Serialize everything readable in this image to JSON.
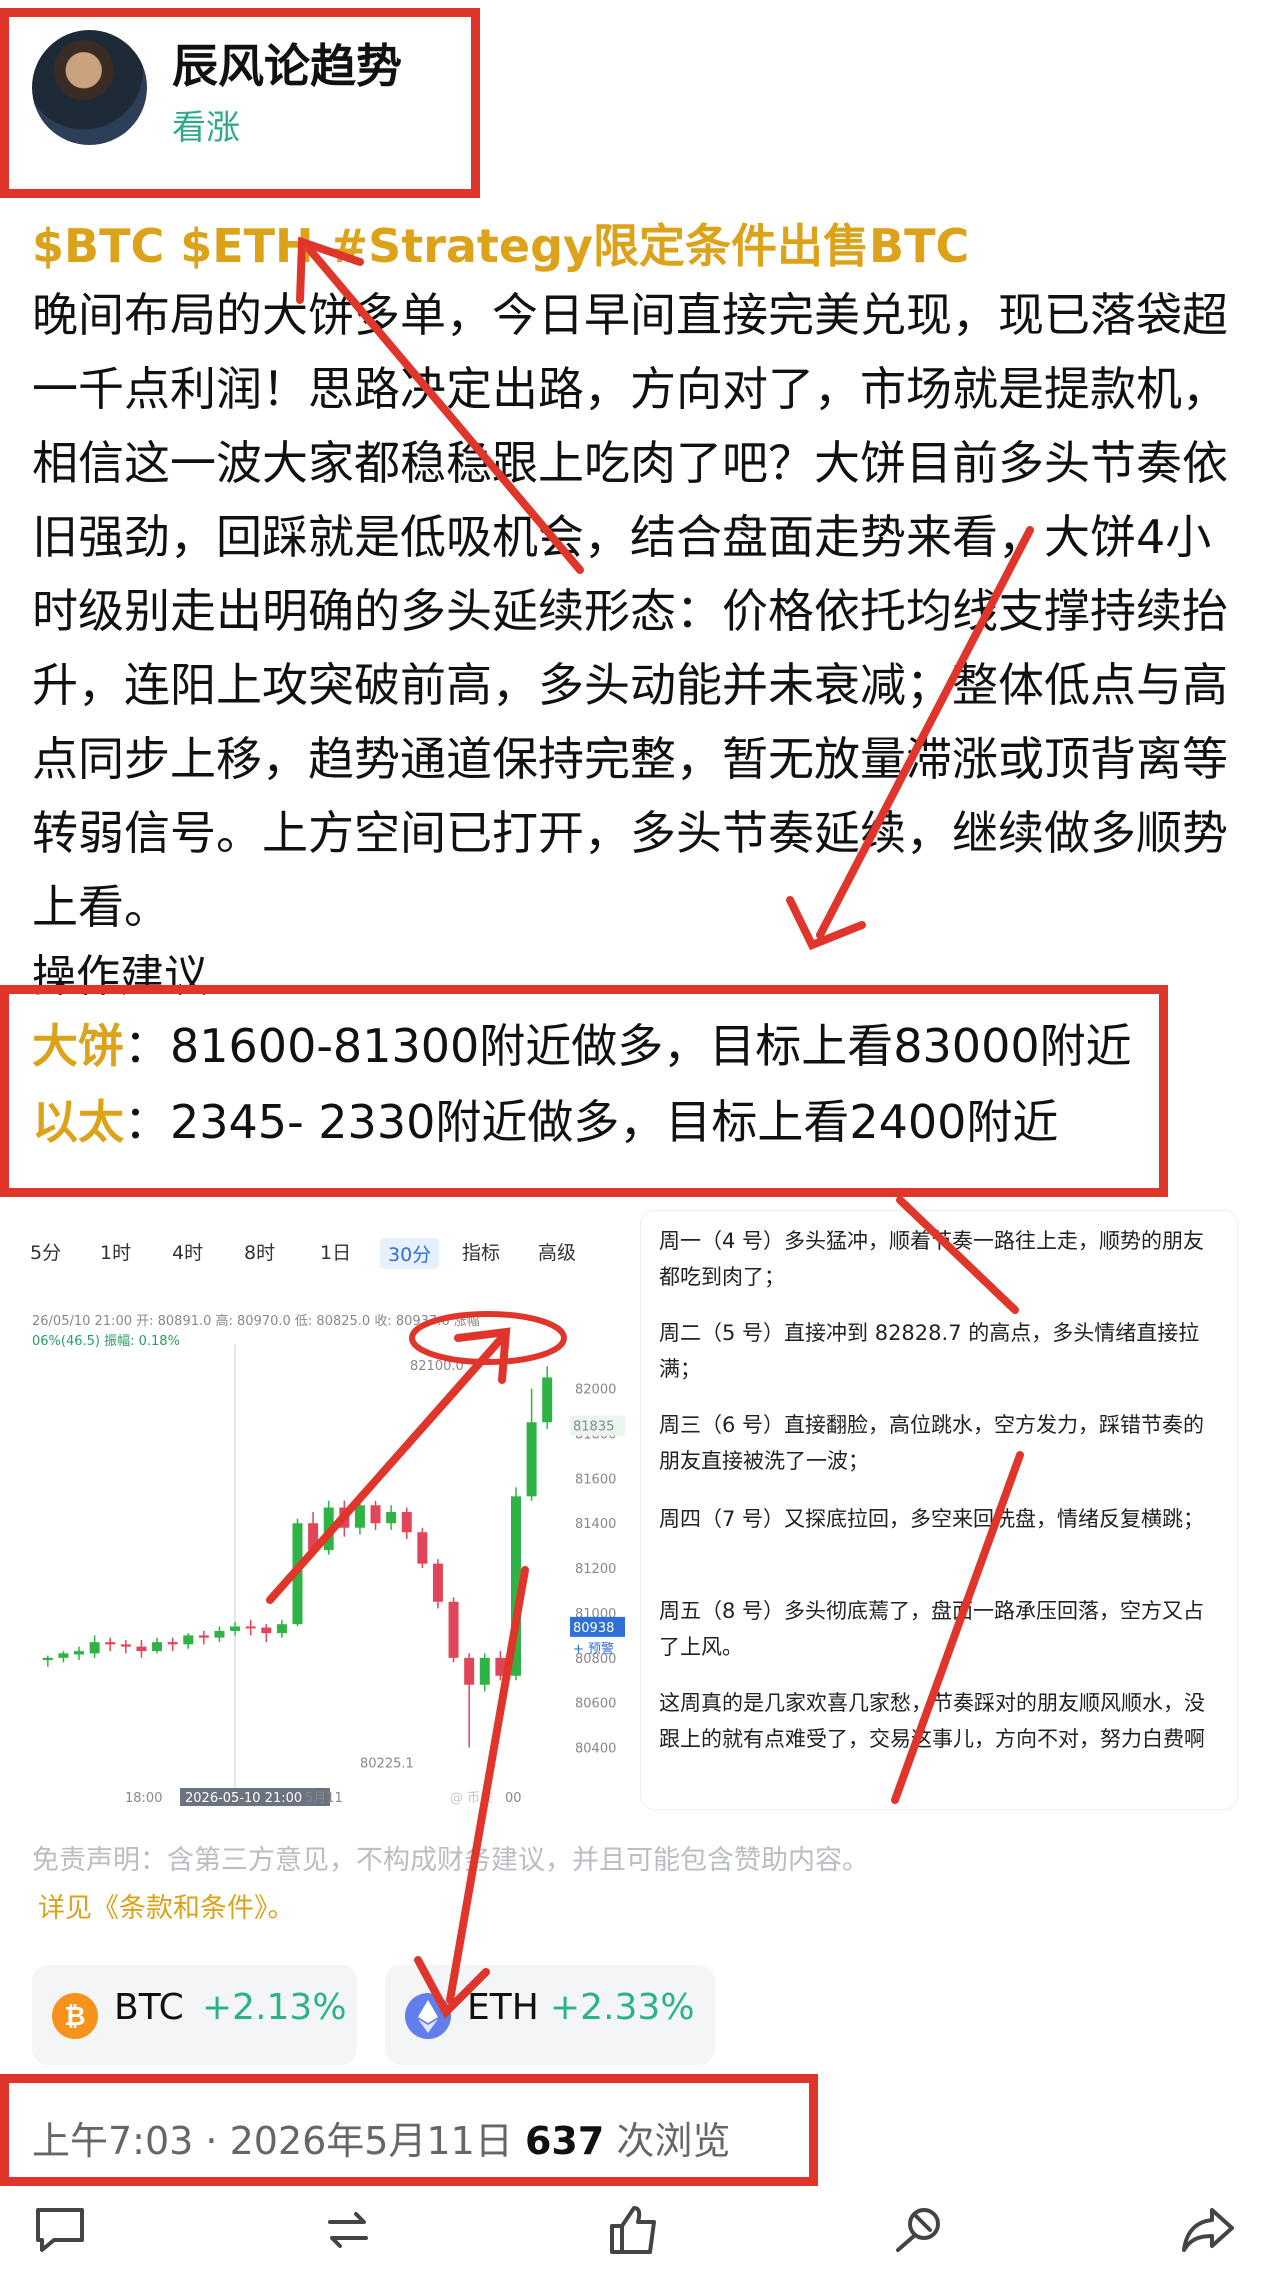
{
  "header": {
    "author_name": "辰风论趋势",
    "stance_badge": "看涨"
  },
  "post": {
    "tags": "$BTC $ETH #Strategy限定条件出售BTC",
    "body": "晚间布局的大饼多单，今日早间直接完美兑现，现已落袋超一千点利润！思路决定出路，方向对了，市场就是提款机，相信这一波大家都稳稳跟上吃肉了吧？大饼目前多头节奏依旧强劲，回踩就是低吸机会，结合盘面走势来看，大饼4小时级别走出明确的多头延续形态：价格依托均线支撑持续抬升，连阳上攻突破前高，多头动能并未衰减；整体低点与高点同步上移，趋势通道保持完整，暂无放量滞涨或顶背离等转弱信号。上方空间已打开，多头节奏延续，继续做多顺势上看。",
    "ops_title": "操作建议",
    "ops": [
      {
        "key": "大饼",
        "text": "：81600-81300附近做多，目标上看83000附近"
      },
      {
        "key": "以太",
        "text": "：2345- 2330附近做多，目标上看2400附近"
      }
    ]
  },
  "chart": {
    "timeframes": [
      "5分",
      "1时",
      "4时",
      "8时",
      "1日",
      "30分",
      "指标",
      "高级"
    ],
    "active_timeframe": "30分",
    "ohlc_line": "26/05/10 21:00 开: 80891.0 高: 80970.0 低: 80825.0 收: 80937.6 涨幅",
    "amp_line": "06%(46.5) 振幅: 0.18%",
    "high_label": "82100.0",
    "low_label": "80225.1",
    "price_tag": "81835",
    "price_tag2": "80938",
    "pred_label": "+ 预警",
    "y_ticks": [
      "82000",
      "81800",
      "81600",
      "81400",
      "81200",
      "81000",
      "80800",
      "80600",
      "80400"
    ],
    "x_labels": [
      "18:00",
      "2026-05-10 21:00",
      "5月11",
      "00"
    ],
    "watermark": "@ 币安",
    "colors": {
      "up": "#2fb345",
      "down": "#e0455a",
      "accent": "#2f6fd6"
    }
  },
  "chart_data": {
    "type": "candlestick",
    "title": "",
    "xlabel": "",
    "ylabel": "",
    "ylim": [
      80300,
      82150
    ],
    "candles": [
      [
        80790,
        80800,
        80760,
        80810
      ],
      [
        80800,
        80820,
        80780,
        80830
      ],
      [
        80815,
        80830,
        80790,
        80850
      ],
      [
        80820,
        80870,
        80800,
        80900
      ],
      [
        80870,
        80860,
        80830,
        80890
      ],
      [
        80860,
        80850,
        80820,
        80880
      ],
      [
        80850,
        80830,
        80800,
        80880
      ],
      [
        80830,
        80870,
        80820,
        80890
      ],
      [
        80870,
        80860,
        80830,
        80890
      ],
      [
        80860,
        80900,
        80840,
        80910
      ],
      [
        80900,
        80890,
        80860,
        80920
      ],
      [
        80890,
        80920,
        80870,
        80940
      ],
      [
        80920,
        80940,
        80900,
        80960
      ],
      [
        80940,
        80935,
        80900,
        80970
      ],
      [
        80935,
        80910,
        80870,
        80950
      ],
      [
        80910,
        80950,
        80890,
        80970
      ],
      [
        80950,
        81400,
        80940,
        81420
      ],
      [
        81400,
        81280,
        81250,
        81450
      ],
      [
        81280,
        81470,
        81260,
        81500
      ],
      [
        81470,
        81380,
        81340,
        81500
      ],
      [
        81380,
        81480,
        81350,
        81520
      ],
      [
        81480,
        81400,
        81370,
        81500
      ],
      [
        81400,
        81450,
        81370,
        81480
      ],
      [
        81450,
        81360,
        81330,
        81470
      ],
      [
        81360,
        81220,
        81200,
        81380
      ],
      [
        81220,
        81050,
        81020,
        81240
      ],
      [
        81050,
        80800,
        80780,
        81070
      ],
      [
        80800,
        80680,
        80400,
        80820
      ],
      [
        80680,
        80800,
        80650,
        80820
      ],
      [
        80800,
        80720,
        80700,
        80830
      ],
      [
        80720,
        81520,
        80700,
        81560
      ],
      [
        81520,
        81850,
        81500,
        82000
      ],
      [
        81850,
        82050,
        81820,
        82100
      ]
    ]
  },
  "notes": [
    "周一（4 号）多头猛冲，顺着节奏一路往上走，顺势的朋友都吃到肉了；",
    "周二（5 号）直接冲到 82828.7 的高点，多头情绪直接拉满；",
    "周三（6 号）直接翻脸，高位跳水，空方发力，踩错节奏的朋友直接被洗了一波；",
    "周四（7 号）又探底拉回，多空来回洗盘，情绪反复横跳；",
    "周五（8 号）多头彻底蔫了，盘面一路承压回落，空方又占了上风。",
    "这周真的是几家欢喜几家愁，节奏踩对的朋友顺风顺水，没跟上的就有点难受了，交易这事儿，方向不对，努力白费啊"
  ],
  "disclaimer": {
    "text": "免责声明：含第三方意见，不构成财务建议，并且可能包含赞助内容。",
    "link": "详见《条款和条件》。"
  },
  "tickers": [
    {
      "symbol": "BTC",
      "change": "+2.13%",
      "color": "#f7931a"
    },
    {
      "symbol": "ETH",
      "change": "+2.33%",
      "color": "#627eea"
    }
  ],
  "meta": {
    "time": "上午7:03",
    "sep": " · ",
    "date": "2026年5月11日",
    "views": "637",
    "views_label": " 次浏览"
  },
  "annotation_color": "#e0352b"
}
